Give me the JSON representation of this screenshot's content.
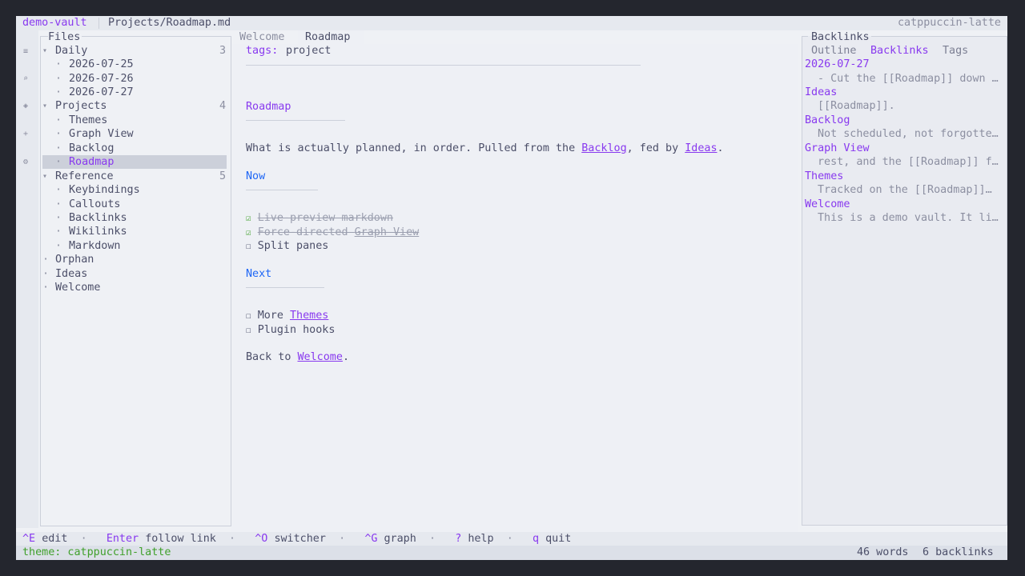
{
  "titlebar": {
    "vault": "demo-vault",
    "path": "Projects/Roadmap.md",
    "theme": "catppuccin-latte"
  },
  "rail": {
    "icons": [
      "≡",
      "⌕",
      "◈",
      "+",
      "⚙"
    ]
  },
  "files": {
    "title": "Files",
    "groups": [
      {
        "label": "Daily",
        "count": "3",
        "caret": "▾",
        "items": [
          "2026-07-25",
          "2026-07-26",
          "2026-07-27"
        ]
      },
      {
        "label": "Projects",
        "count": "4",
        "caret": "▾",
        "items": [
          "Themes",
          "Graph View",
          "Backlog",
          "Roadmap"
        ]
      },
      {
        "label": "Reference",
        "count": "5",
        "caret": "▾",
        "items": [
          "Keybindings",
          "Callouts",
          "Backlinks",
          "Wikilinks",
          "Markdown"
        ]
      }
    ],
    "loose": [
      "Orphan",
      "Ideas",
      "Welcome"
    ],
    "bullet": "·"
  },
  "tabs": [
    "Welcome",
    "Roadmap"
  ],
  "editor": {
    "tags_key": "tags:",
    "tags_value": "project",
    "heading": "Roadmap",
    "intro_before": "What is actually planned, in order. Pulled from the ",
    "intro_link1": "Backlog",
    "intro_mid": ", fed by ",
    "intro_link2": "Ideas",
    "intro_end": ".",
    "now_heading": "Now",
    "now_items": [
      {
        "box": "☑",
        "text": "Live-preview markdown"
      },
      {
        "box": "☑",
        "text_before": "Force-directed ",
        "link": "Graph View"
      },
      {
        "box": "☐",
        "text": "Split panes"
      }
    ],
    "next_heading": "Next",
    "next_items": [
      {
        "box": "☐",
        "text_before": "More ",
        "link": "Themes"
      },
      {
        "box": "☐",
        "text": "Plugin hooks"
      }
    ],
    "back_before": "Back to ",
    "back_link": "Welcome",
    "back_end": "."
  },
  "right": {
    "title": "Backlinks",
    "tabs": [
      "Outline",
      "Backlinks",
      "Tags"
    ],
    "entries": [
      {
        "name": "2026-07-27",
        "snippet": "- Cut the [[Roadmap]] down …"
      },
      {
        "name": "Ideas",
        "snippet": "[[Roadmap]]."
      },
      {
        "name": "Backlog",
        "snippet": "Not scheduled, not forgotte…"
      },
      {
        "name": "Graph View",
        "snippet": "rest, and the [[Roadmap]] f…"
      },
      {
        "name": "Themes",
        "snippet": "Tracked on the [[Roadmap]]…"
      },
      {
        "name": "Welcome",
        "snippet": "This is a demo vault. It li…"
      }
    ]
  },
  "hints": [
    {
      "key": "^E",
      "label": "edit"
    },
    {
      "key": "Enter",
      "label": "follow link"
    },
    {
      "key": "^O",
      "label": "switcher"
    },
    {
      "key": "^G",
      "label": "graph"
    },
    {
      "key": "?",
      "label": "help"
    },
    {
      "key": "q",
      "label": "quit"
    }
  ],
  "hint_sep": "·",
  "status": {
    "theme": "theme: catppuccin-latte",
    "words": "46 words",
    "backlinks": "6 backlinks"
  },
  "colors": {
    "accent": "#8839ef",
    "heading": "#1e66f5",
    "ok": "#40a02b",
    "bg": "#eff1f5"
  }
}
